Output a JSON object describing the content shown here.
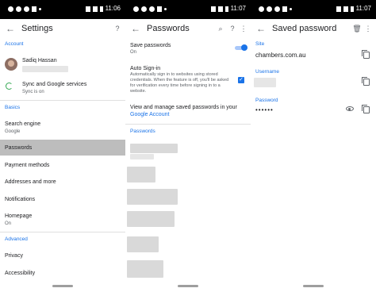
{
  "settings_screen": {
    "status_time": "11:06",
    "title": "Settings",
    "account_section": "Account",
    "user_name": "Sadiq Hassan",
    "sync_title": "Sync and Google services",
    "sync_status": "Sync is on",
    "basics_section": "Basics",
    "items": [
      {
        "label": "Search engine",
        "sub": "Google"
      },
      {
        "label": "Passwords",
        "sub": ""
      },
      {
        "label": "Payment methods",
        "sub": ""
      },
      {
        "label": "Addresses and more",
        "sub": ""
      },
      {
        "label": "Notifications",
        "sub": ""
      },
      {
        "label": "Homepage",
        "sub": "On"
      }
    ],
    "advanced_section": "Advanced",
    "advanced_items": [
      {
        "label": "Privacy"
      },
      {
        "label": "Accessibility"
      }
    ]
  },
  "passwords_screen": {
    "status_time": "11:07",
    "title": "Passwords",
    "save_passwords_label": "Save passwords",
    "save_passwords_status": "On",
    "save_passwords_enabled": true,
    "auto_signin_label": "Auto Sign-in",
    "auto_signin_desc": "Automatically sign in to websites using stored credentials. When the feature is off, you'll be asked for verification every time before signing in to a website.",
    "auto_signin_checked": true,
    "manage_text": "View and manage saved passwords in your",
    "manage_link": "Google Account",
    "passwords_section": "Passwords"
  },
  "saved_password_screen": {
    "status_time": "11:07",
    "title": "Saved password",
    "site_label": "Site",
    "site_value": "chambers.com.au",
    "username_label": "Username",
    "password_label": "Password",
    "password_value": "••••••"
  },
  "icons": {
    "back": "arrow-back-icon",
    "help": "help-icon",
    "search": "search-icon",
    "more": "more-vert-icon",
    "delete": "delete-icon",
    "copy": "copy-icon",
    "eye": "visibility-icon",
    "sync": "sync-icon"
  },
  "colors": {
    "accent": "#1a73e8",
    "selected_row": "#bdbdbd",
    "status_bar": "#000000"
  }
}
